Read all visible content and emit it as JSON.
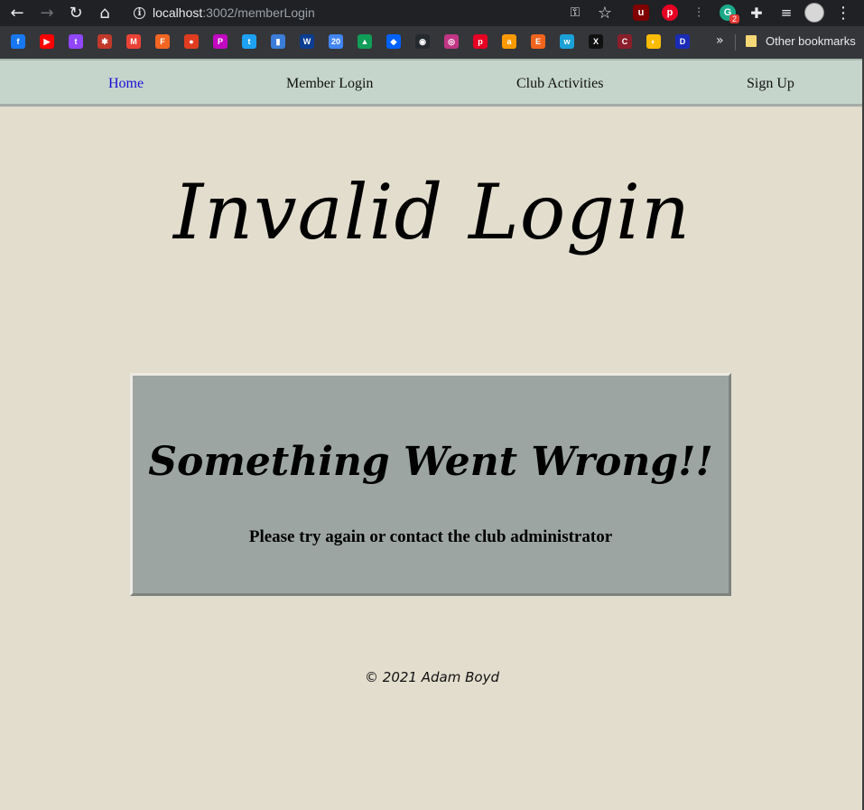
{
  "browser": {
    "url_host": "localhost",
    "url_path": ":3002/memberLogin",
    "extension_badge": "2",
    "other_bookmarks": "Other bookmarks",
    "bookmarks": [
      {
        "icon": "facebook-icon",
        "color": "#1877f2",
        "glyph": "f"
      },
      {
        "icon": "youtube-icon",
        "color": "#ff0000",
        "glyph": "▶"
      },
      {
        "icon": "twitch-icon",
        "color": "#9146ff",
        "glyph": "t"
      },
      {
        "icon": "comic-icon",
        "color": "#c0392b",
        "glyph": "✱"
      },
      {
        "icon": "gmail-icon",
        "color": "#ea4335",
        "glyph": "M"
      },
      {
        "icon": "fandango-icon",
        "color": "#f26522",
        "glyph": "F"
      },
      {
        "icon": "tomato-icon",
        "color": "#e03c20",
        "glyph": "●"
      },
      {
        "icon": "picsart-icon",
        "color": "#c209c1",
        "glyph": "P"
      },
      {
        "icon": "twitter-icon",
        "color": "#1da1f2",
        "glyph": "t"
      },
      {
        "icon": "flag-icon",
        "color": "#3b7dd8",
        "glyph": "▮"
      },
      {
        "icon": "weather-channel-icon",
        "color": "#0b3d91",
        "glyph": "W"
      },
      {
        "icon": "calendar-icon",
        "color": "#4285f4",
        "glyph": "20"
      },
      {
        "icon": "google-drive-icon",
        "color": "#0f9d58",
        "glyph": "▲"
      },
      {
        "icon": "dropbox-icon",
        "color": "#0061ff",
        "glyph": "◆"
      },
      {
        "icon": "github-icon",
        "color": "#24292e",
        "glyph": "◉"
      },
      {
        "icon": "instagram-icon",
        "color": "#c13584",
        "glyph": "◎"
      },
      {
        "icon": "pinterest-icon",
        "color": "#e60023",
        "glyph": "p"
      },
      {
        "icon": "amazon-icon",
        "color": "#ff9900",
        "glyph": "a"
      },
      {
        "icon": "etsy-icon",
        "color": "#f1641e",
        "glyph": "E"
      },
      {
        "icon": "wattpad-icon",
        "color": "#1ba1d8",
        "glyph": "w"
      },
      {
        "icon": "x-icon",
        "color": "#111111",
        "glyph": "X"
      },
      {
        "icon": "codecademy-icon",
        "color": "#8b1e2b",
        "glyph": "C"
      },
      {
        "icon": "chrome-icon",
        "color": "#fbbc05",
        "glyph": "◐"
      },
      {
        "icon": "disney-icon",
        "color": "#1a2bb8",
        "glyph": "D"
      }
    ]
  },
  "nav": {
    "home": "Home",
    "member_login": "Member Login",
    "club_activities": "Club Activities",
    "sign_up": "Sign Up"
  },
  "main": {
    "title": "Invalid Login",
    "error_heading": "Something Went Wrong!!",
    "error_message": "Please try again or contact the club administrator"
  },
  "footer": {
    "copyright": "© 2021 Adam Boyd"
  }
}
